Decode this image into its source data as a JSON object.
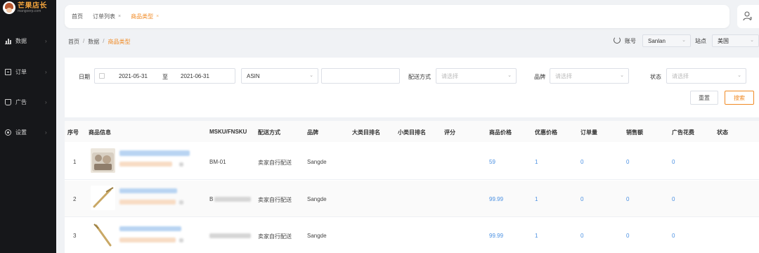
{
  "app": {
    "logo_title": "芒果店长",
    "logo_sub": "mangoerp.com"
  },
  "sidebar": {
    "items": [
      {
        "label": "数据",
        "icon": "bar-chart-icon"
      },
      {
        "label": "订单",
        "icon": "order-icon"
      },
      {
        "label": "广告",
        "icon": "ad-icon"
      },
      {
        "label": "设置",
        "icon": "settings-icon"
      }
    ],
    "arrow": "›"
  },
  "top_tabs": [
    {
      "label": "首页"
    },
    {
      "label": "订单列表",
      "close": "×"
    },
    {
      "label": "商品类型",
      "close": "×"
    }
  ],
  "breadcrumb": {
    "home": "首页",
    "sep": "/",
    "level2": "数据",
    "current": "商品类型"
  },
  "account": {
    "label": "账号",
    "value": "Sanlan",
    "site_label": "站点",
    "site_value": "美国"
  },
  "filters": {
    "date_label": "日期",
    "date_start": "2021-05-31",
    "date_to": "至",
    "date_end": "2021-06-31",
    "asin_select": "ASIN",
    "delivery_label": "配送方式",
    "delivery_placeholder": "请选择",
    "brand_label": "品牌",
    "brand_placeholder": "请选择",
    "status_label": "状态",
    "status_placeholder": "请选择",
    "reset_button": "重置",
    "search_button": "搜索"
  },
  "table": {
    "headers": [
      "序号",
      "商品信息",
      "MSKU/FNSKU",
      "配送方式",
      "品牌",
      "大类目排名",
      "小类目排名",
      "评分",
      "商品价格",
      "优惠价格",
      "订单量",
      "销售额",
      "广告花费",
      "状态"
    ],
    "rows": [
      {
        "index": "1",
        "msku": "BM-01",
        "delivery": "卖家自行配送",
        "brand": "Sangde",
        "price": "59",
        "discount": "1",
        "orders": "0",
        "sales": "0",
        "ad_cost": "0"
      },
      {
        "index": "2",
        "msku": "B",
        "delivery": "卖家自行配送",
        "brand": "Sangde",
        "price": "99.99",
        "discount": "1",
        "orders": "0",
        "sales": "0",
        "ad_cost": "0"
      },
      {
        "index": "3",
        "msku": "",
        "delivery": "卖家自行配送",
        "brand": "Sangde",
        "price": "99.99",
        "discount": "1",
        "orders": "0",
        "sales": "0",
        "ad_cost": "0"
      }
    ]
  },
  "colors": {
    "accent": "#f08a24",
    "link": "#4a90e2",
    "sidebar_bg": "#16171a"
  }
}
